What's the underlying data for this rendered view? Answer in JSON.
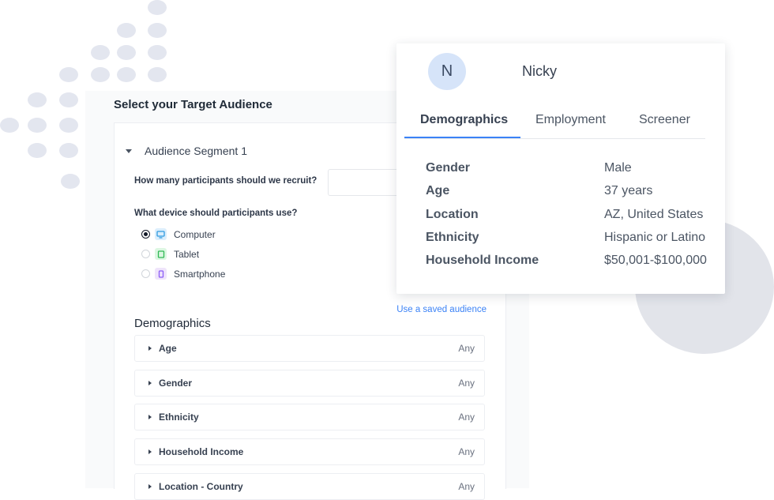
{
  "form": {
    "title": "Select your Target Audience",
    "segment_label": "Audience Segment 1",
    "recruit_question": "How many participants should we recruit?",
    "recruit_value": "",
    "device_question": "What device should participants use?",
    "devices": [
      {
        "label": "Computer",
        "selected": true,
        "icon": "monitor-icon",
        "color": "#2f9be0"
      },
      {
        "label": "Tablet",
        "selected": false,
        "icon": "tablet-icon",
        "color": "#2fb854"
      },
      {
        "label": "Smartphone",
        "selected": false,
        "icon": "smartphone-icon",
        "color": "#8b5cf6"
      }
    ],
    "saved_link": "Use a saved audience",
    "demographics_heading": "Demographics",
    "filters": [
      {
        "label": "Age",
        "value": "Any"
      },
      {
        "label": "Gender",
        "value": "Any"
      },
      {
        "label": "Ethnicity",
        "value": "Any"
      },
      {
        "label": "Household Income",
        "value": "Any"
      },
      {
        "label": "Location - Country",
        "value": "Any"
      }
    ]
  },
  "profile": {
    "initial": "N",
    "name": "Nicky",
    "tabs": [
      "Demographics",
      "Employment",
      "Screener"
    ],
    "active_tab": "Demographics",
    "fields": [
      {
        "label": "Gender",
        "value": "Male"
      },
      {
        "label": "Age",
        "value": "37 years"
      },
      {
        "label": "Location",
        "value": "AZ, United States"
      },
      {
        "label": "Ethnicity",
        "value": "Hispanic or Latino"
      },
      {
        "label": "Household Income",
        "value": "$50,001-$100,000"
      }
    ]
  },
  "colors": {
    "accent": "#3b82f6",
    "avatar_bg": "#d6e4f9",
    "decor": "#e3e6ef"
  }
}
